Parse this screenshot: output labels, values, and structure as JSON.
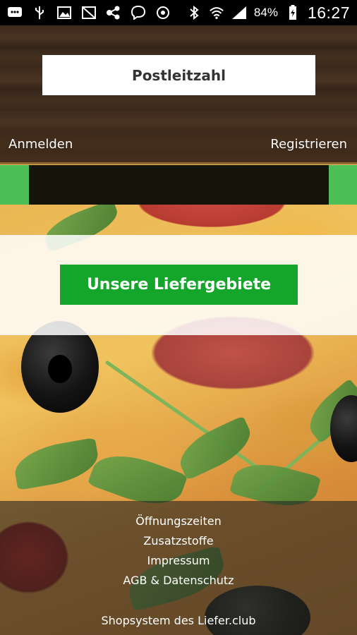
{
  "status_bar": {
    "icons_left": [
      "message-icon",
      "usb-icon",
      "image-icon",
      "photo-off-icon",
      "share-icon",
      "viber-icon",
      "shield-icon"
    ],
    "icons_right": [
      "bluetooth-icon",
      "wifi-icon",
      "signal-icon",
      "battery-icon"
    ],
    "battery": "84%",
    "time": "16:27"
  },
  "header": {
    "postcode_label": "Postleitzahl"
  },
  "auth": {
    "login": "Anmelden",
    "register": "Registrieren"
  },
  "main": {
    "delivery_button": "Unsere Liefergebiete"
  },
  "footer": {
    "links": [
      "Öffnungszeiten",
      "Zusatzstoffe",
      "Impressum",
      "AGB & Datenschutz"
    ],
    "credit": "Shopsystem des Liefer.club"
  },
  "colors": {
    "accent_green": "#13a62a",
    "bar_green": "#4cbf56",
    "dark_box": "#141408"
  }
}
